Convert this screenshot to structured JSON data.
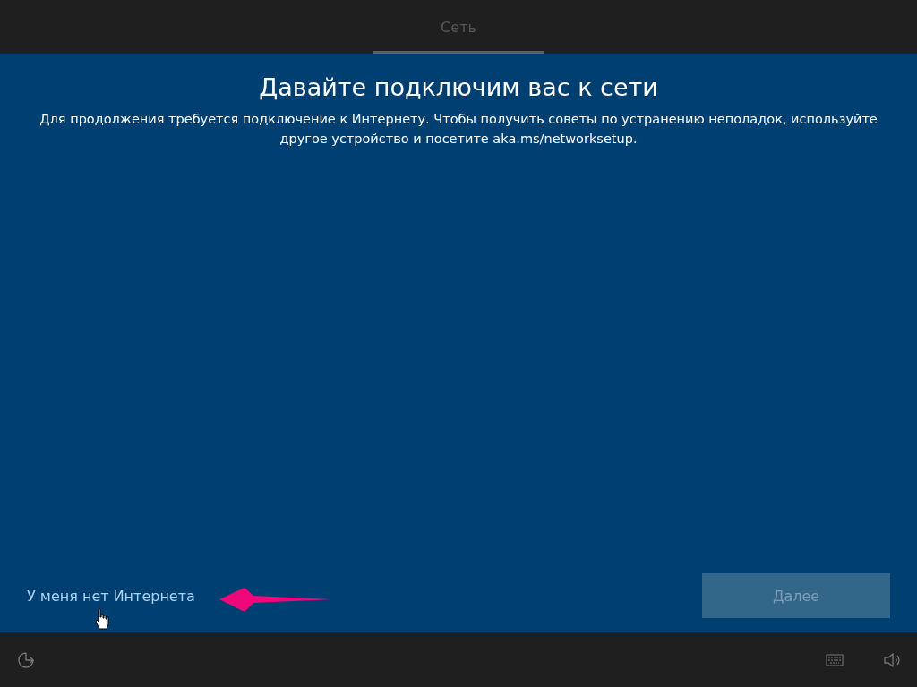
{
  "header": {
    "tabs": [
      {
        "label": "Сеть",
        "selected": true
      }
    ]
  },
  "content": {
    "title": "Давайте подключим вас к сети",
    "description": "Для продолжения требуется подключение к Интернету. Чтобы получить советы по устранению неполадок, используйте другое устройство и посетите aka.ms/networksetup."
  },
  "footer": {
    "link": "У меня нет Интернета",
    "next_button": {
      "label": "Далее",
      "disabled": true
    }
  }
}
